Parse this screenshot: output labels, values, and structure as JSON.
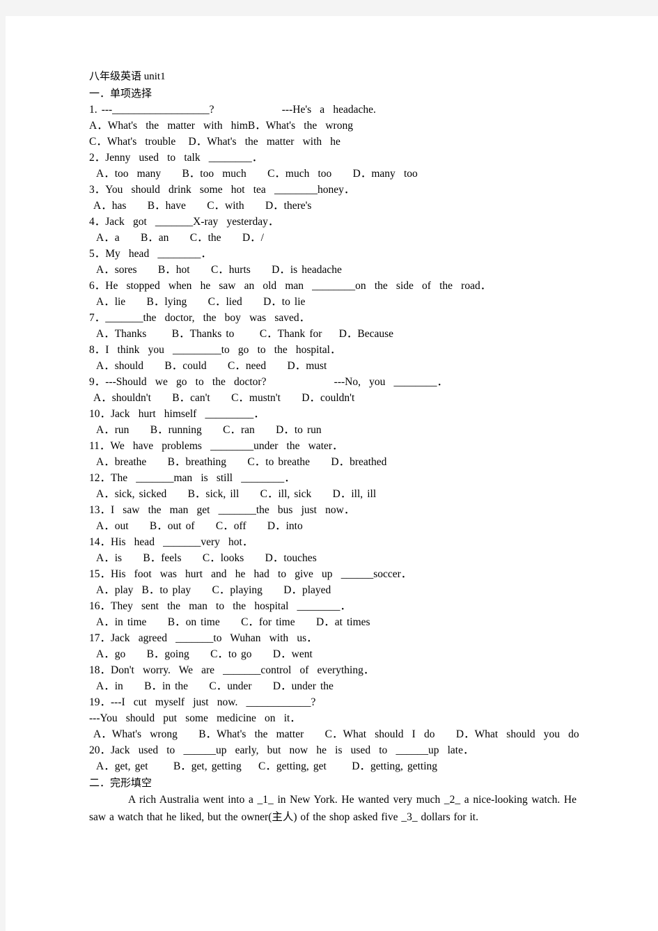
{
  "document": {
    "title": "八年级英语 unit1",
    "title_cn": "八年级英语",
    "title_en": " unit1",
    "section_one_heading": "一．单项选择",
    "section_two_heading": "二．完形填空"
  },
  "questions": [
    {
      "id": "1",
      "stem": "1. ---__________________?                ---He's  a  headache.",
      "option_lines": [
        "A．What's  the  matter  with  himB．What's  the  wrong",
        "C．What's  trouble   D．What's  the  matter  with  he"
      ],
      "option_indent": "flush"
    },
    {
      "id": "2",
      "stem": "2．Jenny  used  to  talk  ________．",
      "option_lines": [
        "A．too  many     B．too  much     C．much  too     D．many  too"
      ],
      "option_indent": "normal"
    },
    {
      "id": "3",
      "stem": "3．You  should  drink  some  hot  tea  ________honey．",
      "option_lines": [
        "A．has     B．have     C．with     D．there's"
      ],
      "option_indent": "narrow"
    },
    {
      "id": "4",
      "stem": "4．Jack  got  _______X-ray  yesterday．",
      "option_lines": [
        "A．a     B．an     C．the     D．/"
      ],
      "option_indent": "normal"
    },
    {
      "id": "5",
      "stem": "5．My  head  ________．",
      "option_lines": [
        "A．sores     B．hot     C．hurts     D．is headache"
      ],
      "option_indent": "normal"
    },
    {
      "id": "6",
      "stem": "6．He  stopped  when  he  saw  an  old  man  ________on  the  side  of  the  road．",
      "option_lines": [
        "A．lie     B．lying     C．lied     D．to lie"
      ],
      "option_indent": "normal"
    },
    {
      "id": "7",
      "stem": "7．_______the  doctor,  the  boy  was  saved．",
      "option_lines": [
        "A．Thanks      B．Thanks to      C．Thank for    D．Because"
      ],
      "option_indent": "normal"
    },
    {
      "id": "8",
      "stem": "8．I  think  you  _________to  go  to  the  hospital．",
      "option_lines": [
        "A．should     B．could     C．need     D．must"
      ],
      "option_indent": "normal"
    },
    {
      "id": "9",
      "stem": "9．---Should  we  go  to  the  doctor?                ---No,  you  ________．",
      "option_lines": [
        "A．shouldn't     B．can't     C．mustn't     D．couldn't"
      ],
      "option_indent": "narrow"
    },
    {
      "id": "10",
      "stem": "10．Jack  hurt  himself  _________．",
      "option_lines": [
        "A．run     B．running     C．ran     D．to run"
      ],
      "option_indent": "normal"
    },
    {
      "id": "11",
      "stem": "11．We  have  problems  ________under  the  water．",
      "option_lines": [
        "A．breathe     B．breathing     C．to breathe     D．breathed"
      ],
      "option_indent": "normal"
    },
    {
      "id": "12",
      "stem": "12．The  _______man  is  still  ________．",
      "option_lines": [
        "A．sick, sicked     B．sick, ill     C．ill, sick     D．ill, ill"
      ],
      "option_indent": "normal"
    },
    {
      "id": "13",
      "stem": "13．I  saw  the  man  get  _______the  bus  just  now．",
      "option_lines": [
        "A．out     B．out of     C．off     D．into"
      ],
      "option_indent": "normal"
    },
    {
      "id": "14",
      "stem": "14．His  head  _______very  hot．",
      "option_lines": [
        "A．is     B．feels     C．looks     D．touches"
      ],
      "option_indent": "normal"
    },
    {
      "id": "15",
      "stem": "15．His  foot  was  hurt  and  he  had  to  give  up  ______soccer．",
      "option_lines": [
        "A．play  B．to play     C．playing     D．played"
      ],
      "option_indent": "normal"
    },
    {
      "id": "16",
      "stem": "16．They  sent  the  man  to  the  hospital  ________．",
      "option_lines": [
        "A．in time     B．on time     C．for time     D．at times"
      ],
      "option_indent": "normal"
    },
    {
      "id": "17",
      "stem": "17．Jack  agreed  _______to  Wuhan  with  us．",
      "option_lines": [
        "A．go     B．going     C．to go     D．went"
      ],
      "option_indent": "normal"
    },
    {
      "id": "18",
      "stem": "18．Don't  worry.  We  are  _______control  of  everything．",
      "option_lines": [
        "A．in     B．in the     C．under     D．under the"
      ],
      "option_indent": "normal"
    },
    {
      "id": "19",
      "stem": "19．---I  cut  myself  just  now.  ____________?",
      "continuation": "---You  should  put  some  medicine  on  it．",
      "option_lines": [
        "A．What's  wrong     B．What's  the  matter     C．What  should  I  do     D．What  should  you  do"
      ],
      "option_indent": "narrow"
    },
    {
      "id": "20",
      "stem": "20．Jack  used  to  ______up  early,  but  now  he  is  used  to  ______up  late．",
      "option_lines": [
        "A．get, get      B．get, getting    C．getting, get      D．getting, getting"
      ],
      "option_indent": "normal"
    }
  ],
  "cloze": {
    "paragraph_part1": "A  rich  Australia  went  into  a  _1_  in  New  York.  He  wanted  very  much  _2_  a  nice-looking  watch.  He  saw  a  watch  that  he  liked,  but  the  owner(",
    "paragraph_cn": "主人",
    "paragraph_part2": ")  of  the  shop  asked  five  _3_  dollars  for  it."
  }
}
